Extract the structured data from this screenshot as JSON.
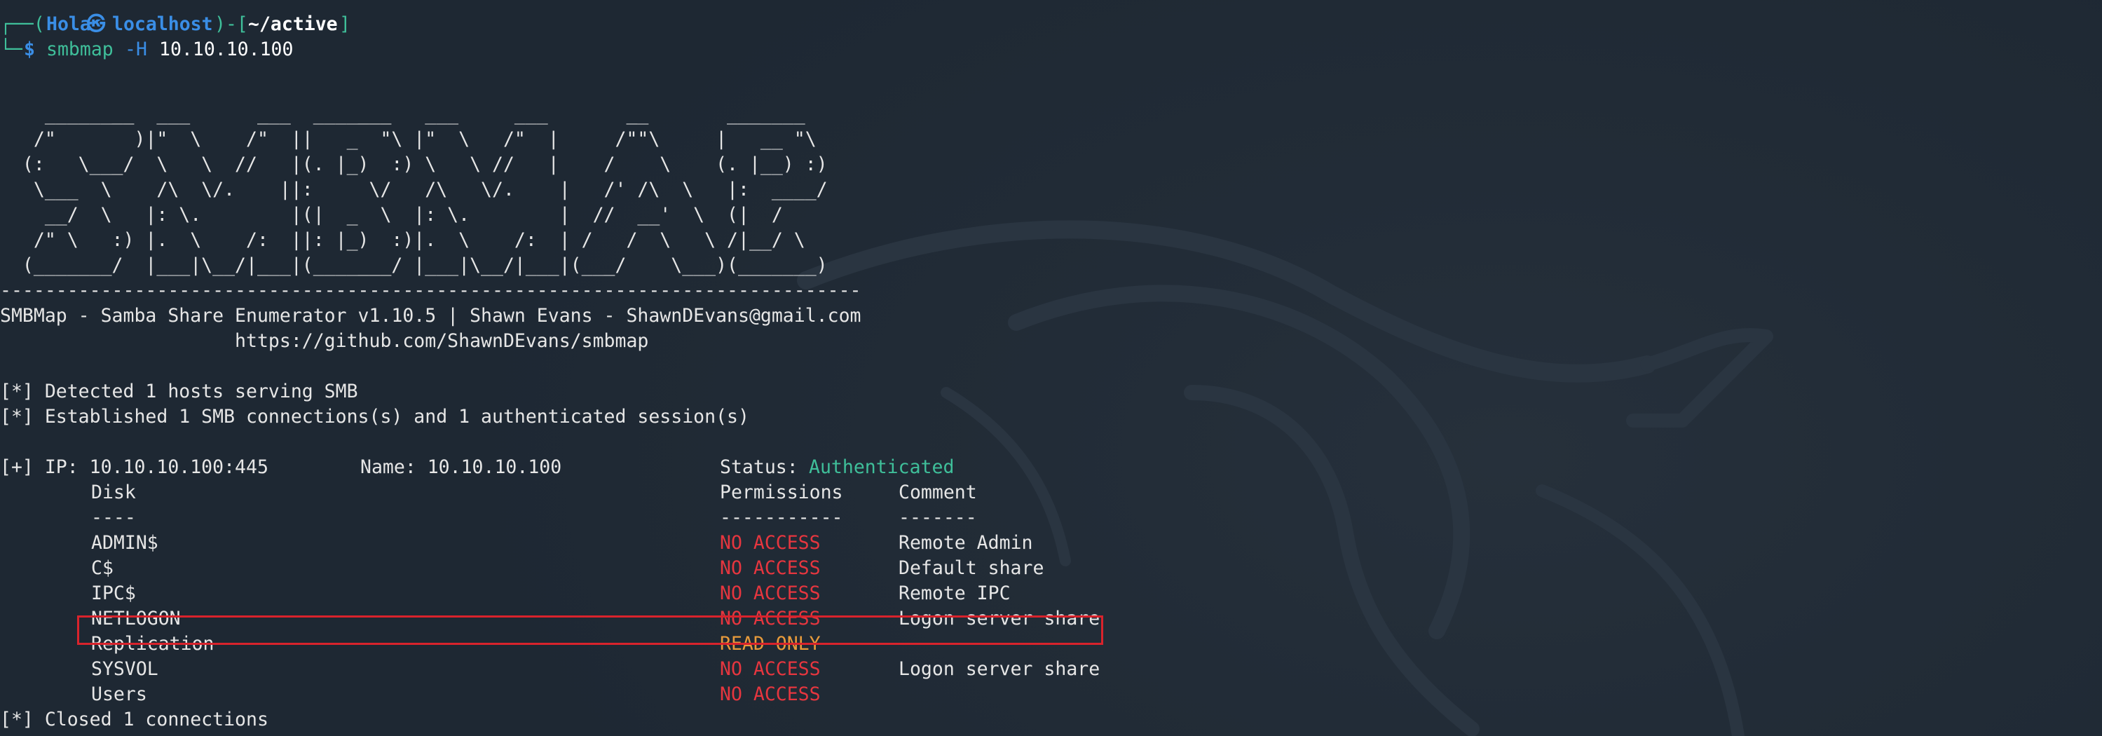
{
  "prompt": {
    "frame_top": "┌──(",
    "user": "Hola",
    "at_symbol": "㉿",
    "host": "localhost",
    "sep": ")-[",
    "path": "~/active",
    "close": "]",
    "frame_bottom": "└─",
    "dollar": "$",
    "command": "smbmap",
    "flag": "-H",
    "target": "10.10.10.100"
  },
  "banner": {
    "ascii": "    ________  ___      ___  _______   ___     ___       __       _______\n   /\"       )|\"  \\    /\"  ||   _  \"\\ |\"  \\   /\"  |     /\"\"\\     |   __ \"\\\n  (:   \\___/  \\   \\  //   |(. |_)  :) \\   \\ //   |    /    \\    (. |__) :)\n   \\___  \\    /\\  \\/.    ||:     \\/   /\\   \\/.    |   /' /\\  \\   |:  ____/\n    __/  \\   |: \\.        |(|  _  \\  |: \\.        |  //  __'  \\  (|  /\n   /\" \\   :) |.  \\    /:  ||: |_)  :)|.  \\    /:  | /   /  \\   \\ /|__/ \\\n  (_______/  |___|\\__/|___|(_______/ |___|\\__/|___|(___/    \\___)(_______)",
    "divider": "-----------------------------------------------------------------------------",
    "title_line": "SMBMap - Samba Share Enumerator v1.10.5 | Shawn Evans - ShawnDEvans@gmail.com",
    "url_line": "                     https://github.com/ShawnDEvans/smbmap"
  },
  "output": {
    "detected": "[*] Detected 1 hosts serving SMB",
    "established": "[*] Established 1 SMB connections(s) and 1 authenticated session(s)",
    "ip_label": "[+] IP: 10.10.10.100:445",
    "name_label": "Name: 10.10.10.100",
    "status_label": "Status:",
    "status_value": "Authenticated",
    "closed": "[*] Closed 1 connections"
  },
  "table": {
    "headers": {
      "disk": "Disk",
      "permissions": "Permissions",
      "comment": "Comment"
    },
    "underlines": {
      "disk": "----",
      "permissions": "-----------",
      "comment": "-------"
    },
    "rows": [
      {
        "disk": "ADMIN$",
        "permissions": "NO ACCESS",
        "comment": "Remote Admin"
      },
      {
        "disk": "C$",
        "permissions": "NO ACCESS",
        "comment": "Default share"
      },
      {
        "disk": "IPC$",
        "permissions": "NO ACCESS",
        "comment": "Remote IPC"
      },
      {
        "disk": "NETLOGON",
        "permissions": "NO ACCESS",
        "comment": "Logon server share"
      },
      {
        "disk": "Replication",
        "permissions": "READ ONLY",
        "comment": ""
      },
      {
        "disk": "SYSVOL",
        "permissions": "NO ACCESS",
        "comment": "Logon server share"
      },
      {
        "disk": "Users",
        "permissions": "NO ACCESS",
        "comment": ""
      }
    ]
  },
  "colors": {
    "background": "#1e2833",
    "prompt_blue": "#3a8ee6",
    "prompt_green": "#3fbf9a",
    "status_green": "#3fbf9a",
    "no_access_red": "#e6363f",
    "read_only_orange": "#e89b3c",
    "highlight_box": "#d9232c"
  },
  "icons": {
    "background": "kali-dragon-watermark-icon"
  }
}
